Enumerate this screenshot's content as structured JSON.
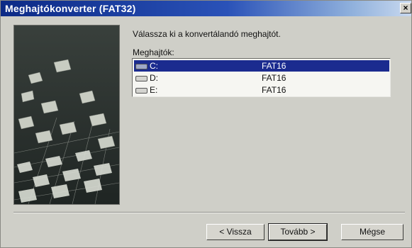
{
  "window": {
    "title": "Meghajtókonverter (FAT32)",
    "close_label": "×"
  },
  "content": {
    "prompt": "Válassza ki a konvertálandó meghajtót.",
    "drives_label": "Meghajtók:",
    "drives": [
      {
        "letter": "C:",
        "fs": "FAT16",
        "selected": true
      },
      {
        "letter": "D:",
        "fs": "FAT16",
        "selected": false
      },
      {
        "letter": "E:",
        "fs": "FAT16",
        "selected": false
      }
    ]
  },
  "buttons": {
    "back": "< Vissza",
    "next": "Tovább >",
    "cancel": "Mégse"
  },
  "colors": {
    "title_start": "#0c2a86",
    "selection": "#1b2b8f",
    "face": "#cfcfc8"
  }
}
